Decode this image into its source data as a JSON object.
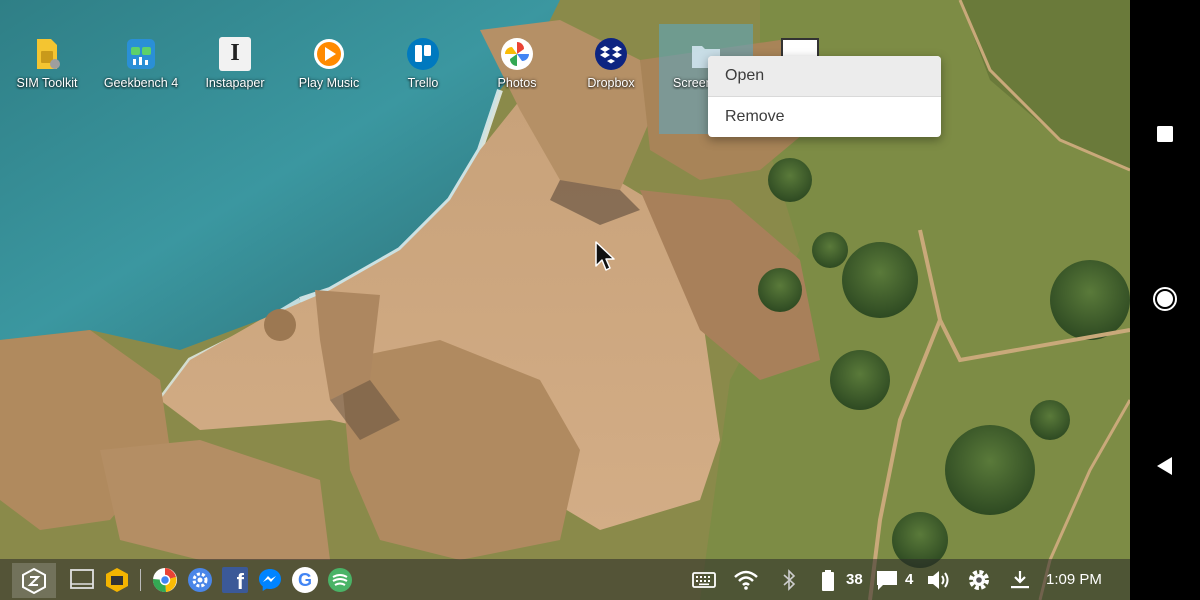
{
  "desktop": {
    "icons": [
      {
        "label": "SIM Toolkit",
        "icon": "sim-toolkit-icon"
      },
      {
        "label": "Geekbench 4",
        "icon": "geekbench-icon"
      },
      {
        "label": "Instapaper",
        "icon": "instapaper-icon"
      },
      {
        "label": "Play Music",
        "icon": "play-music-icon"
      },
      {
        "label": "Trello",
        "icon": "trello-icon"
      },
      {
        "label": "Photos",
        "icon": "photos-icon"
      },
      {
        "label": "Dropbox",
        "icon": "dropbox-icon"
      },
      {
        "label": "Screen",
        "icon": "folder-icon"
      }
    ],
    "instapaper_glyph": "I"
  },
  "context_menu": {
    "items": [
      {
        "label": "Open"
      },
      {
        "label": "Remove"
      }
    ]
  },
  "taskbar": {
    "apps": [
      "sentio-launcher-icon",
      "desktop-icon",
      "file-manager-icon",
      "chrome-icon",
      "settings-app-icon",
      "facebook-icon",
      "messenger-icon",
      "google-icon",
      "pushbullet-icon"
    ],
    "facebook_glyph": "f",
    "google_glyph": "G",
    "battery_level": "38",
    "notification_count": "4",
    "clock": "1:09 PM"
  },
  "colors": {
    "taskbar_bg": "#2a2a2a",
    "selection": "#5aaac8",
    "trello": "#0079bf",
    "dropbox": "#0d2481",
    "facebook": "#3b5998"
  }
}
